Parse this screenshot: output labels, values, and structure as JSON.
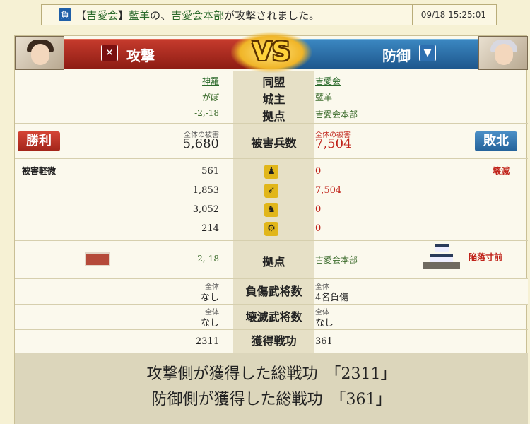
{
  "notice": {
    "badge": "負",
    "msg_1": "【",
    "alliance": "吉愛会",
    "msg_2": "】",
    "lord": "藍羊",
    "msg_3": "の、",
    "base": "吉愛会本部",
    "msg_4": "が攻撃されました。",
    "time": "09/18 15:25:01"
  },
  "header": {
    "attack_label": "攻撃",
    "defense_label": "防御",
    "vs": "VS"
  },
  "info": {
    "alliance": {
      "label": "同盟",
      "atk": "神羅",
      "def": "吉愛会"
    },
    "lord": {
      "label": "城主",
      "atk": "がぼ",
      "def": "藍羊"
    },
    "base": {
      "label": "拠点",
      "atk": "-2,-18",
      "def": "吉愛会本部"
    }
  },
  "damage": {
    "label": "被害兵数",
    "result_atk": "勝利",
    "result_def": "敗北",
    "total_label": "全体の被害",
    "atk_total": "5,680",
    "def_total": "7,504"
  },
  "units": {
    "atk_status": "被害軽微",
    "def_status": "壊滅",
    "rows": [
      {
        "icon": "spearman-icon",
        "atk": "561",
        "def": "0"
      },
      {
        "icon": "archer-icon",
        "atk": "1,853",
        "def": "7,504"
      },
      {
        "icon": "cavalry-icon",
        "atk": "3,052",
        "def": "0"
      },
      {
        "icon": "siege-icon",
        "atk": "214",
        "def": "0"
      }
    ]
  },
  "stronghold": {
    "label": "拠点",
    "atk": "-2,-18",
    "def": "吉愛会本部",
    "def_status": "陥落寸前"
  },
  "wounded": {
    "label": "負傷武将数",
    "total_label": "全体",
    "atk": "なし",
    "def": "4名負傷"
  },
  "destroyed": {
    "label": "壊滅武将数",
    "total_label": "全体",
    "atk": "なし",
    "def": "なし"
  },
  "merit": {
    "label": "獲得戦功",
    "atk": "2311",
    "def": "361"
  },
  "summary": {
    "atk_line": "攻撃側が獲得した総戦功　「2311」",
    "def_line": "防御側が獲得した総戦功　「361」"
  }
}
